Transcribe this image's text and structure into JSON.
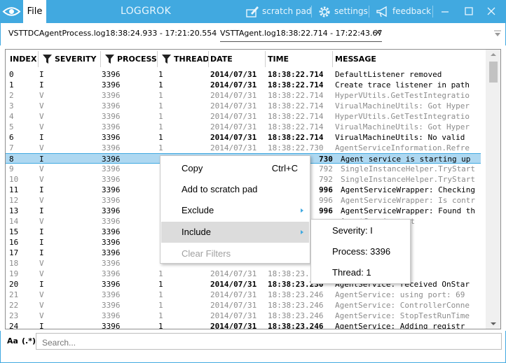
{
  "titlebar": {
    "file_label": "File",
    "app_title": "LOGGROK",
    "scratch_pad_label": "scratch pad",
    "settings_label": "settings",
    "feedback_label": "feedback",
    "minimize_label": "—",
    "maximize_label": "□",
    "close_label": "✕"
  },
  "tabs": [
    {
      "label": "VSTTDCAgentProcess.log18:38:24.933 - 17:21:20.554",
      "active": false
    },
    {
      "label": "VSTTAgent.log18:38:22.714 - 17:22:43.67",
      "active": true,
      "close_label": "✕"
    }
  ],
  "columns": [
    {
      "label": "INDEX",
      "filter": false
    },
    {
      "label": "SEVERITY",
      "filter": true
    },
    {
      "label": "PROCESS",
      "filter": true
    },
    {
      "label": "THREAD",
      "filter": true
    },
    {
      "label": "DATE",
      "filter": false
    },
    {
      "label": "TIME",
      "filter": false
    },
    {
      "label": "MESSAGE",
      "filter": false
    }
  ],
  "rows": [
    {
      "index": "0",
      "severity": "I",
      "process": "3396",
      "thread": "1",
      "date": "2014/07/31",
      "time": "18:38:22.714",
      "message": "DefaultListener removed"
    },
    {
      "index": "1",
      "severity": "I",
      "process": "3396",
      "thread": "1",
      "date": "2014/07/31",
      "time": "18:38:22.714",
      "message": "Create trace listener in path"
    },
    {
      "index": "2",
      "severity": "V",
      "process": "3396",
      "thread": "1",
      "date": "2014/07/31",
      "time": "18:38:22.714",
      "message": "HyperVUtils.GetTestIntegratio"
    },
    {
      "index": "3",
      "severity": "V",
      "process": "3396",
      "thread": "1",
      "date": "2014/07/31",
      "time": "18:38:22.714",
      "message": "VirualMachineUtils: Got Hyper"
    },
    {
      "index": "4",
      "severity": "V",
      "process": "3396",
      "thread": "1",
      "date": "2014/07/31",
      "time": "18:38:22.714",
      "message": "HyperVUtils.GetTestIntegratio"
    },
    {
      "index": "5",
      "severity": "V",
      "process": "3396",
      "thread": "1",
      "date": "2014/07/31",
      "time": "18:38:22.714",
      "message": "VirualMachineUtils: Got Hyper"
    },
    {
      "index": "6",
      "severity": "I",
      "process": "3396",
      "thread": "1",
      "date": "2014/07/31",
      "time": "18:38:22.714",
      "message": "VirualMachineUtils: No valid"
    },
    {
      "index": "7",
      "severity": "V",
      "process": "3396",
      "thread": "1",
      "date": "2014/07/31",
      "time": "18:38:22.730",
      "message": "AgentServiceInformation.Refre"
    },
    {
      "index": "8",
      "severity": "I",
      "process": "3396",
      "thread": "",
      "date": "",
      "time": "730",
      "message": "Agent service is starting up"
    },
    {
      "index": "9",
      "severity": "V",
      "process": "3396",
      "thread": "",
      "date": "",
      "time": "792",
      "message": "SingleInstanceHelper.TryStart"
    },
    {
      "index": "10",
      "severity": "V",
      "process": "3396",
      "thread": "",
      "date": "",
      "time": "792",
      "message": "SingleInstanceHelper.TryStart"
    },
    {
      "index": "11",
      "severity": "I",
      "process": "3396",
      "thread": "",
      "date": "",
      "time": "996",
      "message": "AgentServiceWrapper: Checking"
    },
    {
      "index": "12",
      "severity": "V",
      "process": "3396",
      "thread": "",
      "date": "",
      "time": "996",
      "message": "AgentServiceWrapper: Is contr"
    },
    {
      "index": "13",
      "severity": "I",
      "process": "3396",
      "thread": "",
      "date": "",
      "time": "996",
      "message": "AgentServiceWrapper: Found th"
    },
    {
      "index": "14",
      "severity": "V",
      "process": "3396",
      "thread": "",
      "date": "",
      "time": "",
      "message": "AgentService: st"
    },
    {
      "index": "15",
      "severity": "I",
      "process": "3396",
      "thread": "",
      "date": "",
      "time": "",
      "message": "sing controlle"
    },
    {
      "index": "16",
      "severity": "I",
      "process": "3396",
      "thread": "",
      "date": "",
      "time": "",
      "message": "sing agent nam"
    },
    {
      "index": "17",
      "severity": "I",
      "process": "3396",
      "thread": "",
      "date": "",
      "time": "",
      "message": "sing machine n"
    },
    {
      "index": "18",
      "severity": "V",
      "process": "3396",
      "thread": "",
      "date": "",
      "time": "",
      "message": "che.ForceCache"
    },
    {
      "index": "19",
      "severity": "V",
      "process": "3396",
      "thread": "1",
      "date": "2014/07/31",
      "time": "18:38:23.",
      "message": "AgentService: de"
    },
    {
      "index": "20",
      "severity": "I",
      "process": "3396",
      "thread": "1",
      "date": "2014/07/31",
      "time": "18:38:23.230",
      "message": "AgentService: received OnStar"
    },
    {
      "index": "21",
      "severity": "V",
      "process": "3396",
      "thread": "1",
      "date": "2014/07/31",
      "time": "18:38:23.246",
      "message": "AgentService: using port: 69"
    },
    {
      "index": "22",
      "severity": "V",
      "process": "3396",
      "thread": "1",
      "date": "2014/07/31",
      "time": "18:38:23.246",
      "message": "AgentService: ControllerConne"
    },
    {
      "index": "23",
      "severity": "V",
      "process": "3396",
      "thread": "1",
      "date": "2014/07/31",
      "time": "18:38:23.246",
      "message": "AgentService: StopTestRunTime"
    },
    {
      "index": "24",
      "severity": "I",
      "process": "3396",
      "thread": "1",
      "date": "2014/07/31",
      "time": "18:38:23.246",
      "message": "AgentService: Adding registr"
    }
  ],
  "selected_row_index": "8",
  "context_menu": {
    "items": [
      {
        "label": "Copy",
        "shortcut": "Ctrl+C",
        "submenu": false,
        "disabled": false,
        "highlighted": false
      },
      {
        "label": "Add to scratch pad",
        "shortcut": "",
        "submenu": false,
        "disabled": false,
        "highlighted": false
      },
      {
        "label": "Exclude",
        "shortcut": "",
        "submenu": true,
        "disabled": false,
        "highlighted": false
      },
      {
        "label": "Include",
        "shortcut": "",
        "submenu": true,
        "disabled": false,
        "highlighted": true
      },
      {
        "label": "Clear Filters",
        "shortcut": "",
        "submenu": false,
        "disabled": true,
        "highlighted": false
      }
    ]
  },
  "include_submenu": {
    "items": [
      {
        "label": "Severity: I"
      },
      {
        "label": "Process: 3396"
      },
      {
        "label": "Thread: 1"
      }
    ]
  },
  "search": {
    "case_toggle_label": "Aa",
    "regex_toggle_label": "(.*)",
    "placeholder": "Search..."
  },
  "colors": {
    "accent": "#41a9e0",
    "selected_row": "#aed8f1",
    "verbose_text": "#8c8c8c",
    "menu_highlight": "#dcdcdc"
  },
  "icons": {
    "app_icon": "eye-icon",
    "scratch_pad_icon": "scratch-pad-icon",
    "settings_icon": "gear-icon",
    "feedback_icon": "megaphone-icon",
    "filter_icon": "funnel-icon"
  }
}
